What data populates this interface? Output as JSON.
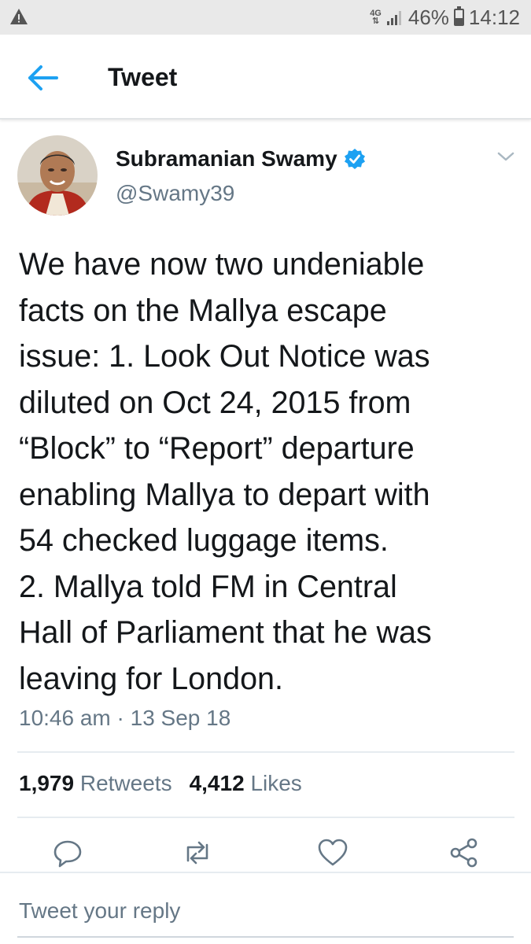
{
  "status_bar": {
    "network": "4G",
    "battery": "46%",
    "battery_level": 0.46,
    "time": "14:12",
    "icons": [
      "warning-icon",
      "signal-icon",
      "battery-icon"
    ]
  },
  "app_bar": {
    "title": "Tweet",
    "back_icon": "back-arrow-icon"
  },
  "tweet": {
    "author_name": "Subramanian Swamy",
    "handle": "@Swamy39",
    "verified": true,
    "text": "We have now two undeniable\nfacts on the Mallya escape\nissue: 1. Look Out Notice was\ndiluted on Oct 24, 2015 from\n“Block” to “Report” departure\nenabling Mallya to depart with\n54 checked luggage items.\n2. Mallya told FM in Central\nHall of Parliament that he was\nleaving for London.",
    "timestamp": "10:46 am · 13 Sep 18",
    "retweets_count": "1,979",
    "retweets_label": "Retweets",
    "likes_count": "4,412",
    "likes_label": "Likes"
  },
  "actions": [
    "reply-icon",
    "retweet-icon",
    "like-icon",
    "share-icon"
  ],
  "reply": {
    "placeholder": "Tweet your reply"
  },
  "colors": {
    "accent": "#1da1f2",
    "text": "#14171a",
    "secondary": "#657786",
    "status_bar": "#e9e9e9"
  }
}
